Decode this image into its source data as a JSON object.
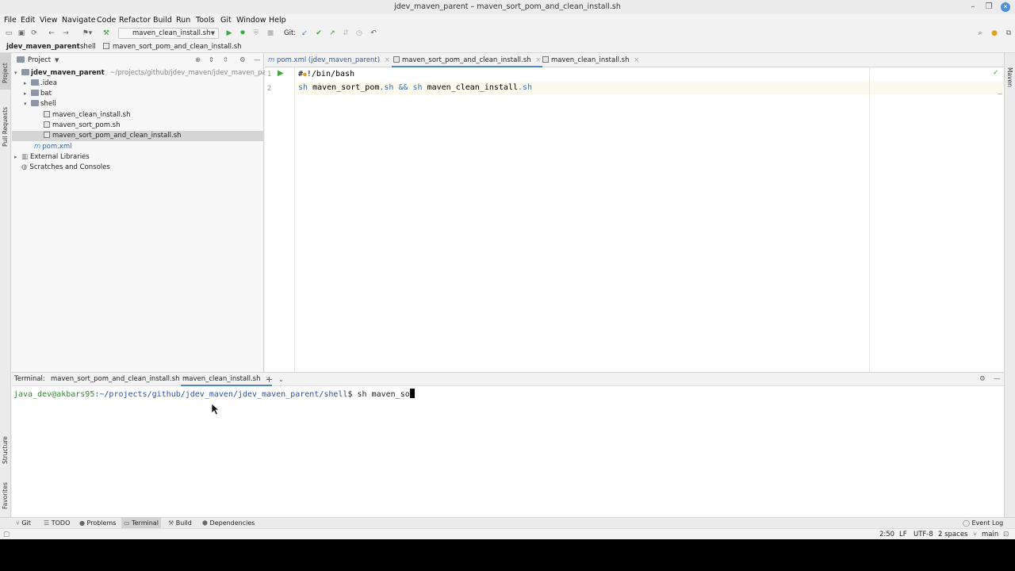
{
  "window": {
    "title": "jdev_maven_parent – maven_sort_pom_and_clean_install.sh"
  },
  "menu": [
    "File",
    "Edit",
    "View",
    "Navigate",
    "Code",
    "Refactor",
    "Build",
    "Run",
    "Tools",
    "Git",
    "Window",
    "Help"
  ],
  "toolbar": {
    "run_config": "maven_clean_install.sh",
    "git_label": "Git:"
  },
  "breadcrumb": [
    "jdev_maven_parent",
    "shell",
    "maven_sort_pom_and_clean_install.sh"
  ],
  "left_stripe": {
    "project": "Project",
    "pull_requests": "Pull Requests",
    "structure": "Structure",
    "favorites": "Favorites"
  },
  "right_stripe": {
    "maven": "Maven"
  },
  "project_panel": {
    "title": "Project",
    "root_name": "jdev_maven_parent",
    "root_path": "~/projects/github/jdev_maven/jdev_maven_parent",
    "items": [
      ".idea",
      "bat",
      "shell",
      "maven_clean_install.sh",
      "maven_sort_pom.sh",
      "maven_sort_pom_and_clean_install.sh",
      "pom.xml",
      "External Libraries",
      "Scratches and Consoles"
    ]
  },
  "editor": {
    "tabs": [
      "pom.xml (jdev_maven_parent)",
      "maven_sort_pom_and_clean_install.sh",
      "maven_clean_install.sh"
    ],
    "line_numbers": [
      "1",
      "2"
    ],
    "lines": {
      "l1_a": "#",
      "l1_b": "!/bin/bash",
      "l2_sh1": "sh",
      "l2_a": " maven_sort_pom",
      "l2_ext1": ".sh",
      "l2_b": " ",
      "l2_amp": "&&",
      "l2_c": " ",
      "l2_sh2": "sh",
      "l2_d": " maven_clean_install",
      "l2_ext2": ".sh"
    }
  },
  "terminal": {
    "label": "Terminal:",
    "tabs": [
      "maven_sort_pom_and_clean_install.sh",
      "maven_clean_install.sh"
    ],
    "prompt_user": "java_dev@akbars95",
    "prompt_path": ":~/projects/github/jdev_maven/jdev_maven_parent/shell",
    "prompt_sym": "$",
    "command": " sh maven_so"
  },
  "bottom_tools": [
    "Git",
    "TODO",
    "Problems",
    "Terminal",
    "Build",
    "Dependencies"
  ],
  "event_log": "Event Log",
  "status": {
    "position": "2:50",
    "line_sep": "LF",
    "encoding": "UTF-8",
    "indent": "2 spaces",
    "branch": "main"
  },
  "colors": {
    "accent": "#4a88c7",
    "prompt_green": "#2e8b2e",
    "prompt_blue": "#2b4fa8",
    "sh_keyword": "#3b6fb0",
    "run_green": "#3aa83a"
  }
}
